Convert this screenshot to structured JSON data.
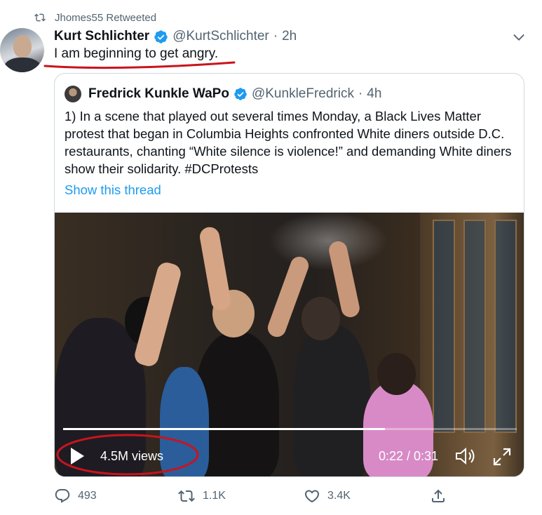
{
  "retweet": {
    "text": "Jhomes55 Retweeted",
    "icon": "retweet-icon"
  },
  "tweet": {
    "author_name": "Kurt Schlichter",
    "handle": "@KurtSchlichter",
    "separator": "·",
    "time": "2h",
    "text": "I am beginning to get angry.",
    "verified_icon": "verified-badge-icon",
    "menu_icon": "chevron-down-icon"
  },
  "quote": {
    "author_name": "Fredrick Kunkle WaPo",
    "handle": "@KunkleFredrick",
    "separator": "·",
    "time": "4h",
    "text": "1) In a scene that played out several times Monday, a Black Lives Matter protest that began in Columbia Heights confronted White diners outside D.C. restaurants,  chanting “White silence is violence!” and demanding White diners show their solidarity. #DCProtests",
    "show_thread": "Show this thread"
  },
  "video": {
    "views": "4.5M views",
    "time": "0:22 / 0:31",
    "progress": 0.71,
    "icons": [
      "play-icon",
      "volume-icon",
      "fullscreen-icon"
    ]
  },
  "actions": {
    "reply_count": "493",
    "retweet_count": "1.1K",
    "like_count": "3.4K",
    "icons": [
      "reply-icon",
      "retweet-icon",
      "like-icon",
      "share-icon"
    ]
  },
  "colors": {
    "accent": "#1d9bf0",
    "secondary_text": "#536471",
    "annotation": "#c8141e"
  }
}
